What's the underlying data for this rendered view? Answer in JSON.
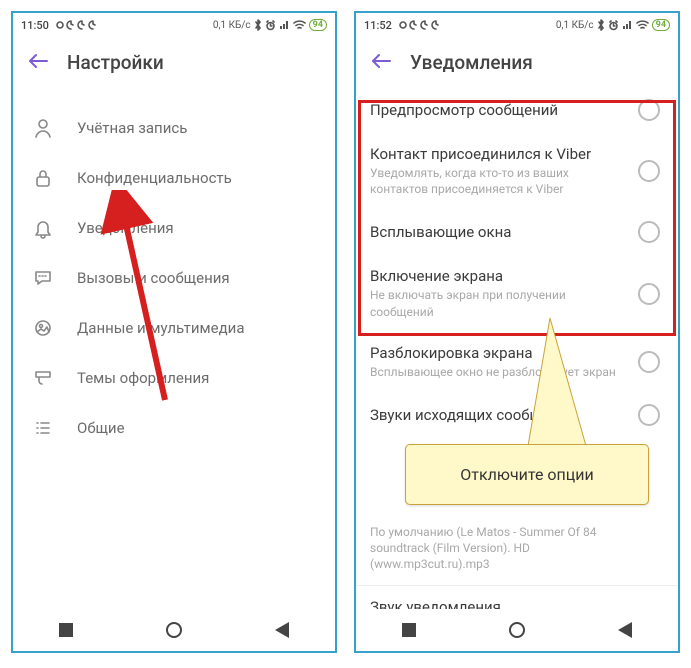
{
  "left": {
    "status": {
      "time": "11:50",
      "net": "0,1 КБ/с",
      "battery": "94"
    },
    "header": {
      "title": "Настройки"
    },
    "items": [
      {
        "label": "Учётная запись"
      },
      {
        "label": "Конфиденциальность"
      },
      {
        "label": "Уведомления"
      },
      {
        "label": "Вызовы и сообщения"
      },
      {
        "label": "Данные и мультимедиа"
      },
      {
        "label": "Темы оформления"
      },
      {
        "label": "Общие"
      }
    ]
  },
  "right": {
    "status": {
      "time": "11:52",
      "net": "0,1 КБ/с",
      "battery": "94"
    },
    "header": {
      "title": "Уведомления"
    },
    "items": [
      {
        "title": "Предпросмотр сообщений",
        "sub": ""
      },
      {
        "title": "Контакт присоединился к Viber",
        "sub": "Уведомлять, когда кто-то из ваших контактов присоединяется к Viber"
      },
      {
        "title": "Всплывающие окна",
        "sub": ""
      },
      {
        "title": "Включение экрана",
        "sub": "Не включать экран при получении сообщений"
      },
      {
        "title": "Разблокировка экрана",
        "sub": "Всплывающее окно не разблокирует экран"
      },
      {
        "title": "Звуки исходящих сообщений",
        "sub": ""
      }
    ],
    "ringtone_sub": "По умолчанию (Le Matos - Summer Of 84 soundtrack (Film Version). HD (www.mp3cut.ru).mp3",
    "sound_title": "Звук уведомления"
  },
  "annotation": {
    "callout_text": "Отключите опции"
  }
}
